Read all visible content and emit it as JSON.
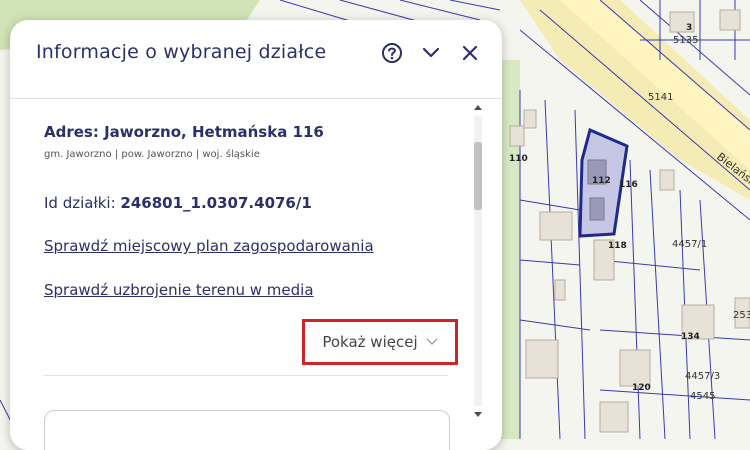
{
  "panel": {
    "title": "Informacje o wybranej działce",
    "address": "Adres: Jaworzno, Hetmańska 116",
    "address_sub": "gm. Jaworzno | pow. Jaworzno | woj. śląskie",
    "id_label": "Id działki:",
    "id_value": "246801_1.0307.4076/1",
    "link_plan": "Sprawdź miejscowy plan zagospodarowania",
    "link_media": "Sprawdź uzbrojenie terenu w media",
    "more_label": "Pokaż więcej"
  },
  "map": {
    "labels": {
      "l3": "3",
      "l5135": "5135",
      "l5141": "5141",
      "l110": "110",
      "l112": "112",
      "l116": "116",
      "l118": "118",
      "l4457_1": "4457/1",
      "l134": "134",
      "l120": "120",
      "l4457_3": "4457/3",
      "l4545": "4545",
      "l253": "253",
      "street": "Bielańsk"
    }
  },
  "colors": {
    "accent": "#2b2f6b",
    "highlight": "#d0232a",
    "selected_parcel": "#1f2a8a"
  }
}
